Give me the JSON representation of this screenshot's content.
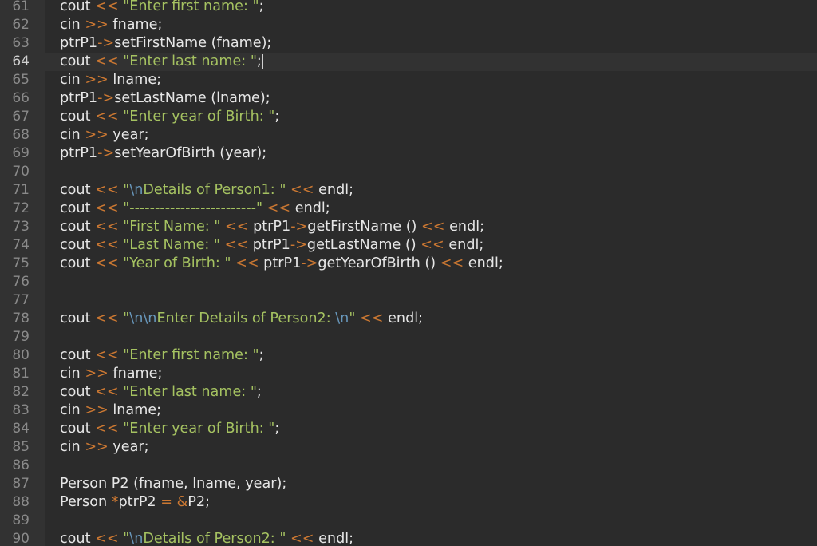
{
  "editor": {
    "current_line": "64",
    "lines": [
      {
        "n": "61",
        "tokens": [
          [
            "t",
            "cout "
          ],
          [
            "o",
            "<<"
          ],
          [
            "t",
            " "
          ],
          [
            "s",
            "\"Enter first name: \""
          ],
          [
            "t",
            ";"
          ]
        ]
      },
      {
        "n": "62",
        "tokens": [
          [
            "t",
            "cin "
          ],
          [
            "o",
            ">>"
          ],
          [
            "t",
            " fname;"
          ]
        ]
      },
      {
        "n": "63",
        "tokens": [
          [
            "t",
            "ptrP1"
          ],
          [
            "o",
            "->"
          ],
          [
            "t",
            "setFirstName (fname);"
          ]
        ]
      },
      {
        "n": "64",
        "tokens": [
          [
            "t",
            "cout "
          ],
          [
            "o",
            "<<"
          ],
          [
            "t",
            " "
          ],
          [
            "s",
            "\"Enter last name: \""
          ],
          [
            "t",
            ";"
          ]
        ],
        "caret": true
      },
      {
        "n": "65",
        "tokens": [
          [
            "t",
            "cin "
          ],
          [
            "o",
            ">>"
          ],
          [
            "t",
            " lname;"
          ]
        ]
      },
      {
        "n": "66",
        "tokens": [
          [
            "t",
            "ptrP1"
          ],
          [
            "o",
            "->"
          ],
          [
            "t",
            "setLastName (lname);"
          ]
        ]
      },
      {
        "n": "67",
        "tokens": [
          [
            "t",
            "cout "
          ],
          [
            "o",
            "<<"
          ],
          [
            "t",
            " "
          ],
          [
            "s",
            "\"Enter year of Birth: \""
          ],
          [
            "t",
            ";"
          ]
        ]
      },
      {
        "n": "68",
        "tokens": [
          [
            "t",
            "cin "
          ],
          [
            "o",
            ">>"
          ],
          [
            "t",
            " year;"
          ]
        ]
      },
      {
        "n": "69",
        "tokens": [
          [
            "t",
            "ptrP1"
          ],
          [
            "o",
            "->"
          ],
          [
            "t",
            "setYearOfBirth (year);"
          ]
        ]
      },
      {
        "n": "70",
        "tokens": []
      },
      {
        "n": "71",
        "tokens": [
          [
            "t",
            "cout "
          ],
          [
            "o",
            "<<"
          ],
          [
            "t",
            " "
          ],
          [
            "s",
            "\""
          ],
          [
            "e",
            "\\n"
          ],
          [
            "s",
            "Details of Person1: \""
          ],
          [
            "t",
            " "
          ],
          [
            "o",
            "<<"
          ],
          [
            "t",
            " endl;"
          ]
        ]
      },
      {
        "n": "72",
        "tokens": [
          [
            "t",
            "cout "
          ],
          [
            "o",
            "<<"
          ],
          [
            "t",
            " "
          ],
          [
            "s",
            "\"-------------------------\""
          ],
          [
            "t",
            " "
          ],
          [
            "o",
            "<<"
          ],
          [
            "t",
            " endl;"
          ]
        ]
      },
      {
        "n": "73",
        "tokens": [
          [
            "t",
            "cout "
          ],
          [
            "o",
            "<<"
          ],
          [
            "t",
            " "
          ],
          [
            "s",
            "\"First Name: \""
          ],
          [
            "t",
            " "
          ],
          [
            "o",
            "<<"
          ],
          [
            "t",
            " ptrP1"
          ],
          [
            "o",
            "->"
          ],
          [
            "t",
            "getFirstName () "
          ],
          [
            "o",
            "<<"
          ],
          [
            "t",
            " endl;"
          ]
        ]
      },
      {
        "n": "74",
        "tokens": [
          [
            "t",
            "cout "
          ],
          [
            "o",
            "<<"
          ],
          [
            "t",
            " "
          ],
          [
            "s",
            "\"Last Name: \""
          ],
          [
            "t",
            " "
          ],
          [
            "o",
            "<<"
          ],
          [
            "t",
            " ptrP1"
          ],
          [
            "o",
            "->"
          ],
          [
            "t",
            "getLastName () "
          ],
          [
            "o",
            "<<"
          ],
          [
            "t",
            " endl;"
          ]
        ]
      },
      {
        "n": "75",
        "tokens": [
          [
            "t",
            "cout "
          ],
          [
            "o",
            "<<"
          ],
          [
            "t",
            " "
          ],
          [
            "s",
            "\"Year of Birth: \""
          ],
          [
            "t",
            " "
          ],
          [
            "o",
            "<<"
          ],
          [
            "t",
            " ptrP1"
          ],
          [
            "o",
            "->"
          ],
          [
            "t",
            "getYearOfBirth () "
          ],
          [
            "o",
            "<<"
          ],
          [
            "t",
            " endl;"
          ]
        ]
      },
      {
        "n": "76",
        "tokens": []
      },
      {
        "n": "77",
        "tokens": []
      },
      {
        "n": "78",
        "tokens": [
          [
            "t",
            "cout "
          ],
          [
            "o",
            "<<"
          ],
          [
            "t",
            " "
          ],
          [
            "s",
            "\""
          ],
          [
            "e",
            "\\n\\n"
          ],
          [
            "s",
            "Enter Details of Person2: "
          ],
          [
            "e",
            "\\n"
          ],
          [
            "s",
            "\""
          ],
          [
            "t",
            " "
          ],
          [
            "o",
            "<<"
          ],
          [
            "t",
            " endl;"
          ]
        ]
      },
      {
        "n": "79",
        "tokens": []
      },
      {
        "n": "80",
        "tokens": [
          [
            "t",
            "cout "
          ],
          [
            "o",
            "<<"
          ],
          [
            "t",
            " "
          ],
          [
            "s",
            "\"Enter first name: \""
          ],
          [
            "t",
            ";"
          ]
        ]
      },
      {
        "n": "81",
        "tokens": [
          [
            "t",
            "cin "
          ],
          [
            "o",
            ">>"
          ],
          [
            "t",
            " fname;"
          ]
        ]
      },
      {
        "n": "82",
        "tokens": [
          [
            "t",
            "cout "
          ],
          [
            "o",
            "<<"
          ],
          [
            "t",
            " "
          ],
          [
            "s",
            "\"Enter last name: \""
          ],
          [
            "t",
            ";"
          ]
        ]
      },
      {
        "n": "83",
        "tokens": [
          [
            "t",
            "cin "
          ],
          [
            "o",
            ">>"
          ],
          [
            "t",
            " lname;"
          ]
        ]
      },
      {
        "n": "84",
        "tokens": [
          [
            "t",
            "cout "
          ],
          [
            "o",
            "<<"
          ],
          [
            "t",
            " "
          ],
          [
            "s",
            "\"Enter year of Birth: \""
          ],
          [
            "t",
            ";"
          ]
        ]
      },
      {
        "n": "85",
        "tokens": [
          [
            "t",
            "cin "
          ],
          [
            "o",
            ">>"
          ],
          [
            "t",
            " year;"
          ]
        ]
      },
      {
        "n": "86",
        "tokens": []
      },
      {
        "n": "87",
        "tokens": [
          [
            "t",
            "Person P2 (fname, lname, year);"
          ]
        ]
      },
      {
        "n": "88",
        "tokens": [
          [
            "t",
            "Person "
          ],
          [
            "o",
            "*"
          ],
          [
            "t",
            "ptrP2 "
          ],
          [
            "o",
            "="
          ],
          [
            "t",
            " "
          ],
          [
            "o",
            "&"
          ],
          [
            "t",
            "P2;"
          ]
        ]
      },
      {
        "n": "89",
        "tokens": []
      },
      {
        "n": "90",
        "tokens": [
          [
            "t",
            "cout "
          ],
          [
            "o",
            "<<"
          ],
          [
            "t",
            " "
          ],
          [
            "s",
            "\""
          ],
          [
            "e",
            "\\n"
          ],
          [
            "s",
            "Details of Person2: \""
          ],
          [
            "t",
            " "
          ],
          [
            "o",
            "<<"
          ],
          [
            "t",
            " endl;"
          ]
        ]
      }
    ]
  },
  "colors": {
    "background": "#2b2b2b",
    "gutter": "#323232",
    "text": "#e6e6e6",
    "operator": "#cc7832",
    "string": "#a5c261",
    "escape": "#6897bb",
    "line_number": "#8a8a8a"
  }
}
